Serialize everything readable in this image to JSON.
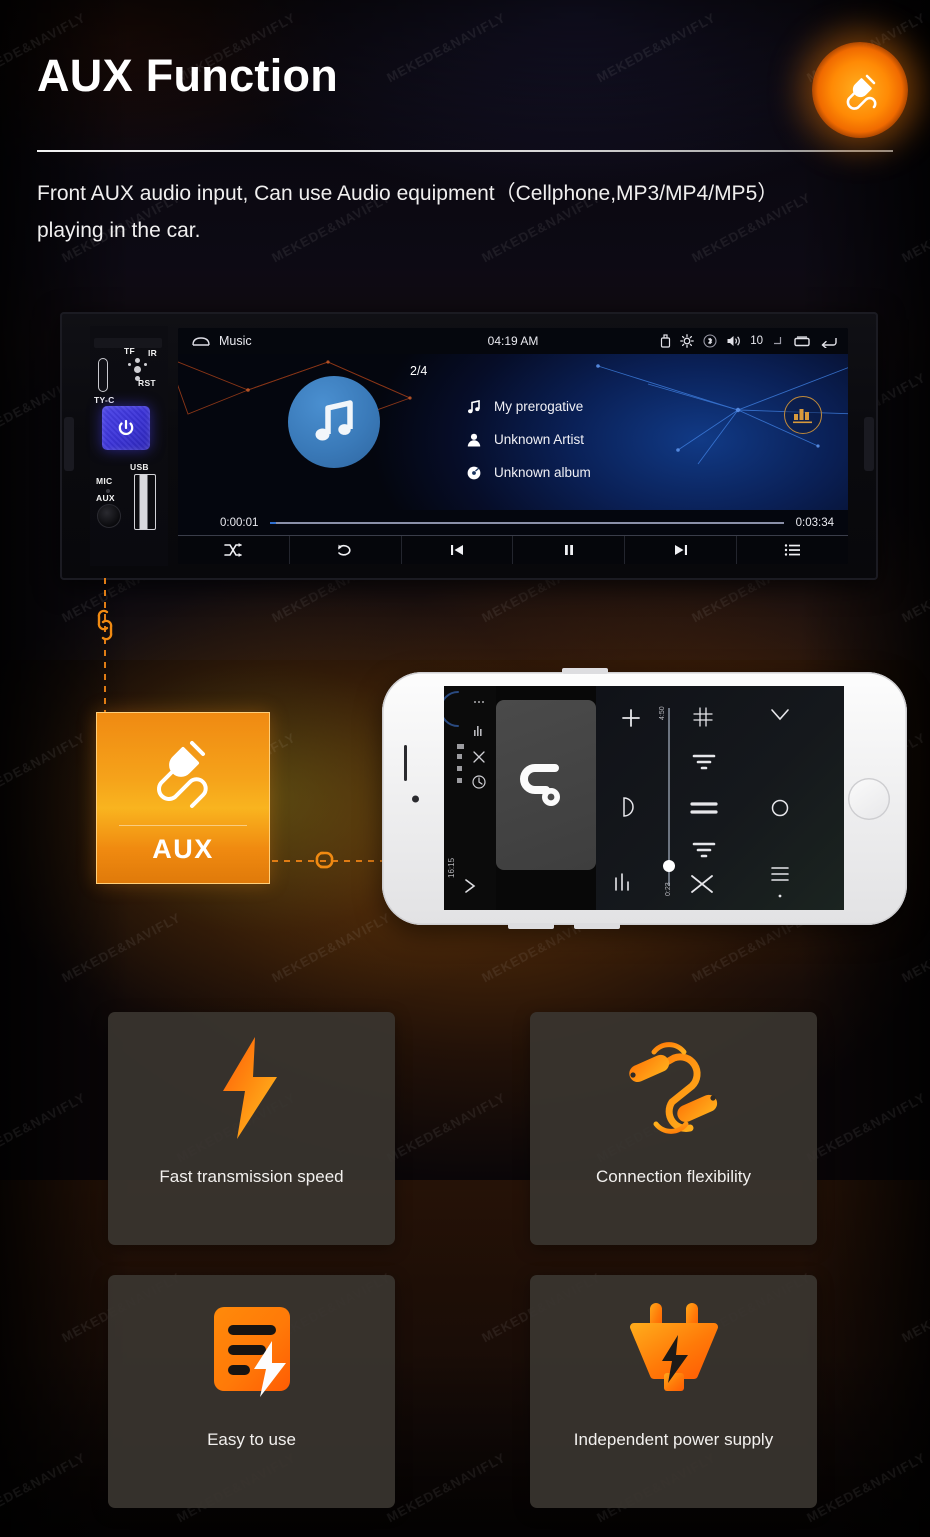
{
  "header": {
    "title": "AUX Function",
    "subtitle": "Front AUX audio input, Can use Audio equipment（Cellphone,MP3/MP4/MP5）playing in the car.",
    "badge_icon": "aux-plug-icon",
    "accent_color": "#f08a12",
    "divider_color": "#f2f2f2"
  },
  "stereo": {
    "panel": {
      "labels": {
        "tf": "TF",
        "ir": "IR",
        "rst": "RST",
        "tyc": "TY-C",
        "mic": "MIC",
        "aux": "AUX",
        "usb": "USB"
      },
      "power_icon": "power-icon",
      "power_color": "#3b33d8"
    },
    "statusbar": {
      "app_icon": "home-cloud-icon",
      "app_title": "Music",
      "clock": "04:19 AM",
      "icons": [
        "usb-icon",
        "brightness-icon",
        "bluetooth-icon",
        "volume-icon"
      ],
      "volume_value": "10",
      "nav_icons": [
        "home-icon",
        "recents-icon",
        "back-icon"
      ]
    },
    "player": {
      "track_index": "2/4",
      "album_art_icon": "music-note-icon",
      "album_art_color": "#3a7ab9",
      "rows": [
        {
          "icon": "music-note-icon",
          "text": "My prerogative"
        },
        {
          "icon": "artist-icon",
          "text": "Unknown Artist"
        },
        {
          "icon": "album-disc-icon",
          "text": "Unknown album"
        }
      ],
      "eq_icon": "equalizer-icon",
      "eq_color": "#d89a3c",
      "elapsed": "0:00:01",
      "duration": "0:03:34",
      "progress_percent": 1,
      "transport": [
        {
          "icon": "shuffle-icon",
          "name": "shuffle-button"
        },
        {
          "icon": "repeat-icon",
          "name": "repeat-button"
        },
        {
          "icon": "previous-icon",
          "name": "previous-button"
        },
        {
          "icon": "pause-icon",
          "name": "pause-button"
        },
        {
          "icon": "next-icon",
          "name": "next-button"
        },
        {
          "icon": "playlist-icon",
          "name": "playlist-button"
        }
      ]
    }
  },
  "aux_card": {
    "label": "AUX",
    "icon": "aux-plug-icon",
    "gradient_from": "#f08a12",
    "gradient_to": "#f9b41f"
  },
  "connectors": {
    "vertical_icon": "chain-link-icon",
    "horizontal_icon": "chain-link-icon",
    "color": "#e07c14"
  },
  "phone": {
    "screen": {
      "clock": "16:15",
      "art_icon": "abstract-logo-icon",
      "slider_top_label": "4:50",
      "slider_bottom_label": "0:23",
      "controls": [
        "plus-icon",
        "crop-icon",
        "chevron-down-icon",
        "play-outline-icon",
        "collapse-up-icon",
        "equals-icon",
        "circle-icon",
        "collapse-down-icon",
        "menu-icon",
        "sort-icon",
        "shuffle-icon",
        "dot-icon"
      ]
    }
  },
  "features": [
    {
      "label": "Fast transmission speed",
      "icon": "lightning-bolt-icon"
    },
    {
      "label": "Connection flexibility",
      "icon": "chain-link-icon"
    },
    {
      "label": "Easy to use",
      "icon": "document-lightning-icon"
    },
    {
      "label": "Independent power supply",
      "icon": "power-plug-icon"
    }
  ],
  "watermark": {
    "text": "MEKEDE&NAVIFLY"
  }
}
